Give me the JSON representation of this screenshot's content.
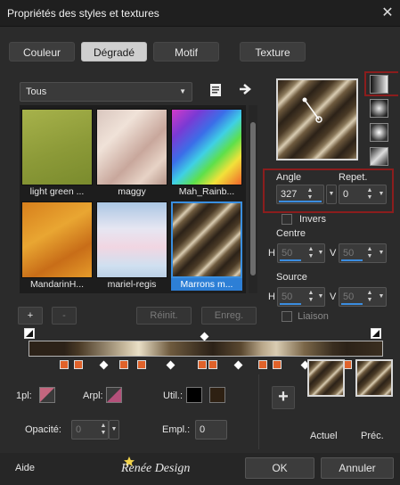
{
  "window": {
    "title": "Propriétés des styles et textures",
    "close_glyph": "✕"
  },
  "tabs": [
    {
      "label": "Couleur",
      "active": false
    },
    {
      "label": "Dégradé",
      "active": true
    },
    {
      "label": "Motif",
      "active": false
    },
    {
      "label": "Texture",
      "active": false
    }
  ],
  "category": {
    "selected": "Tous"
  },
  "icons": {
    "save_icon": "📄",
    "arrow_icon": "➜",
    "plus_glyph": "+",
    "minus_glyph": "-"
  },
  "gallery": {
    "items": [
      {
        "label": "light green ...",
        "selected": false
      },
      {
        "label": "maggy",
        "selected": false
      },
      {
        "label": "Mah_Rainb...",
        "selected": false
      },
      {
        "label": "MandarinH...",
        "selected": false
      },
      {
        "label": "mariel-regis",
        "selected": false
      },
      {
        "label": "Marrons m...",
        "selected": true
      }
    ]
  },
  "gallery_buttons": {
    "add": "+",
    "remove": "-",
    "reset": "Réinit.",
    "save": "Enreg."
  },
  "angle": {
    "label": "Angle",
    "value": "327"
  },
  "repeat": {
    "label": "Repet.",
    "value": "0"
  },
  "invert": {
    "label": "Invers",
    "checked": false
  },
  "center": {
    "label": "Centre",
    "h_label": "H",
    "h_value": "50",
    "v_label": "V",
    "v_value": "50"
  },
  "source": {
    "label": "Source",
    "h_label": "H",
    "h_value": "50",
    "v_label": "V",
    "v_value": "50"
  },
  "link": {
    "label": "Liaison",
    "checked": false
  },
  "gradient_editor": {
    "first_label": "1pl:",
    "background_label": "Arpl:",
    "util_label": "Util.:",
    "opacity_label": "Opacité:",
    "opacity_value": "0",
    "location_label": "Empl.:",
    "location_value": "0",
    "stops": [
      0.1,
      0.14,
      0.27,
      0.32,
      0.49,
      0.52,
      0.66,
      0.7,
      0.86,
      0.9
    ],
    "midpoints": [
      0.21,
      0.4,
      0.59,
      0.78
    ]
  },
  "colors": {
    "stop_orange": "#e0622a",
    "first_plane": "#c4667e",
    "background_plane": "#b4507a",
    "util_black": "#000000",
    "util_brown": "#2e2012",
    "selection_blue": "#3a8fe0",
    "highlight_red": "#8b1d1d"
  },
  "preview": {
    "current_label": "Actuel",
    "previous_label": "Préc.",
    "add_glyph": "+"
  },
  "footer": {
    "help": "Aide",
    "brand": "Renée Design",
    "ok": "OK",
    "cancel": "Annuler"
  }
}
